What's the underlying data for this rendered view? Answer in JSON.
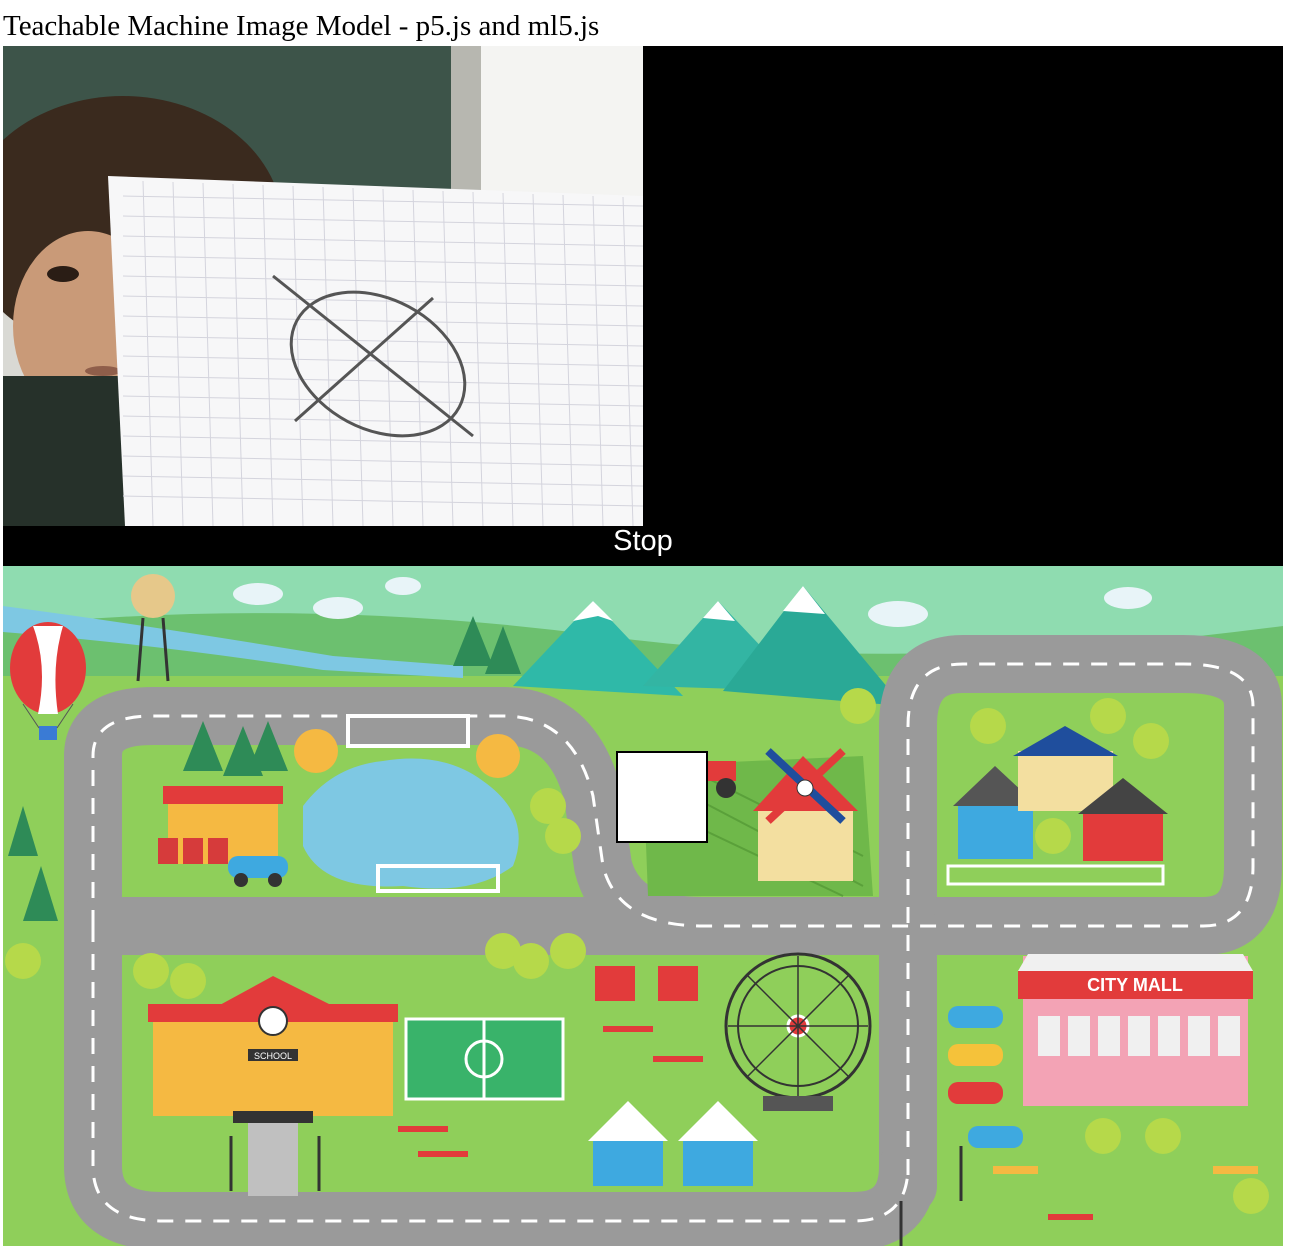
{
  "page": {
    "title": "Teachable Machine Image Model - p5.js and ml5.js"
  },
  "sketch": {
    "prediction_label": "Stop"
  },
  "map": {
    "school_sign": "SCHOOL",
    "mall_sign": "CITY MALL",
    "colors": {
      "grass": "#8fcf5a",
      "road": "#9a9a9a",
      "sky": "#8fdcb0",
      "water": "#7ec8e3",
      "player": "#ffffff"
    }
  }
}
